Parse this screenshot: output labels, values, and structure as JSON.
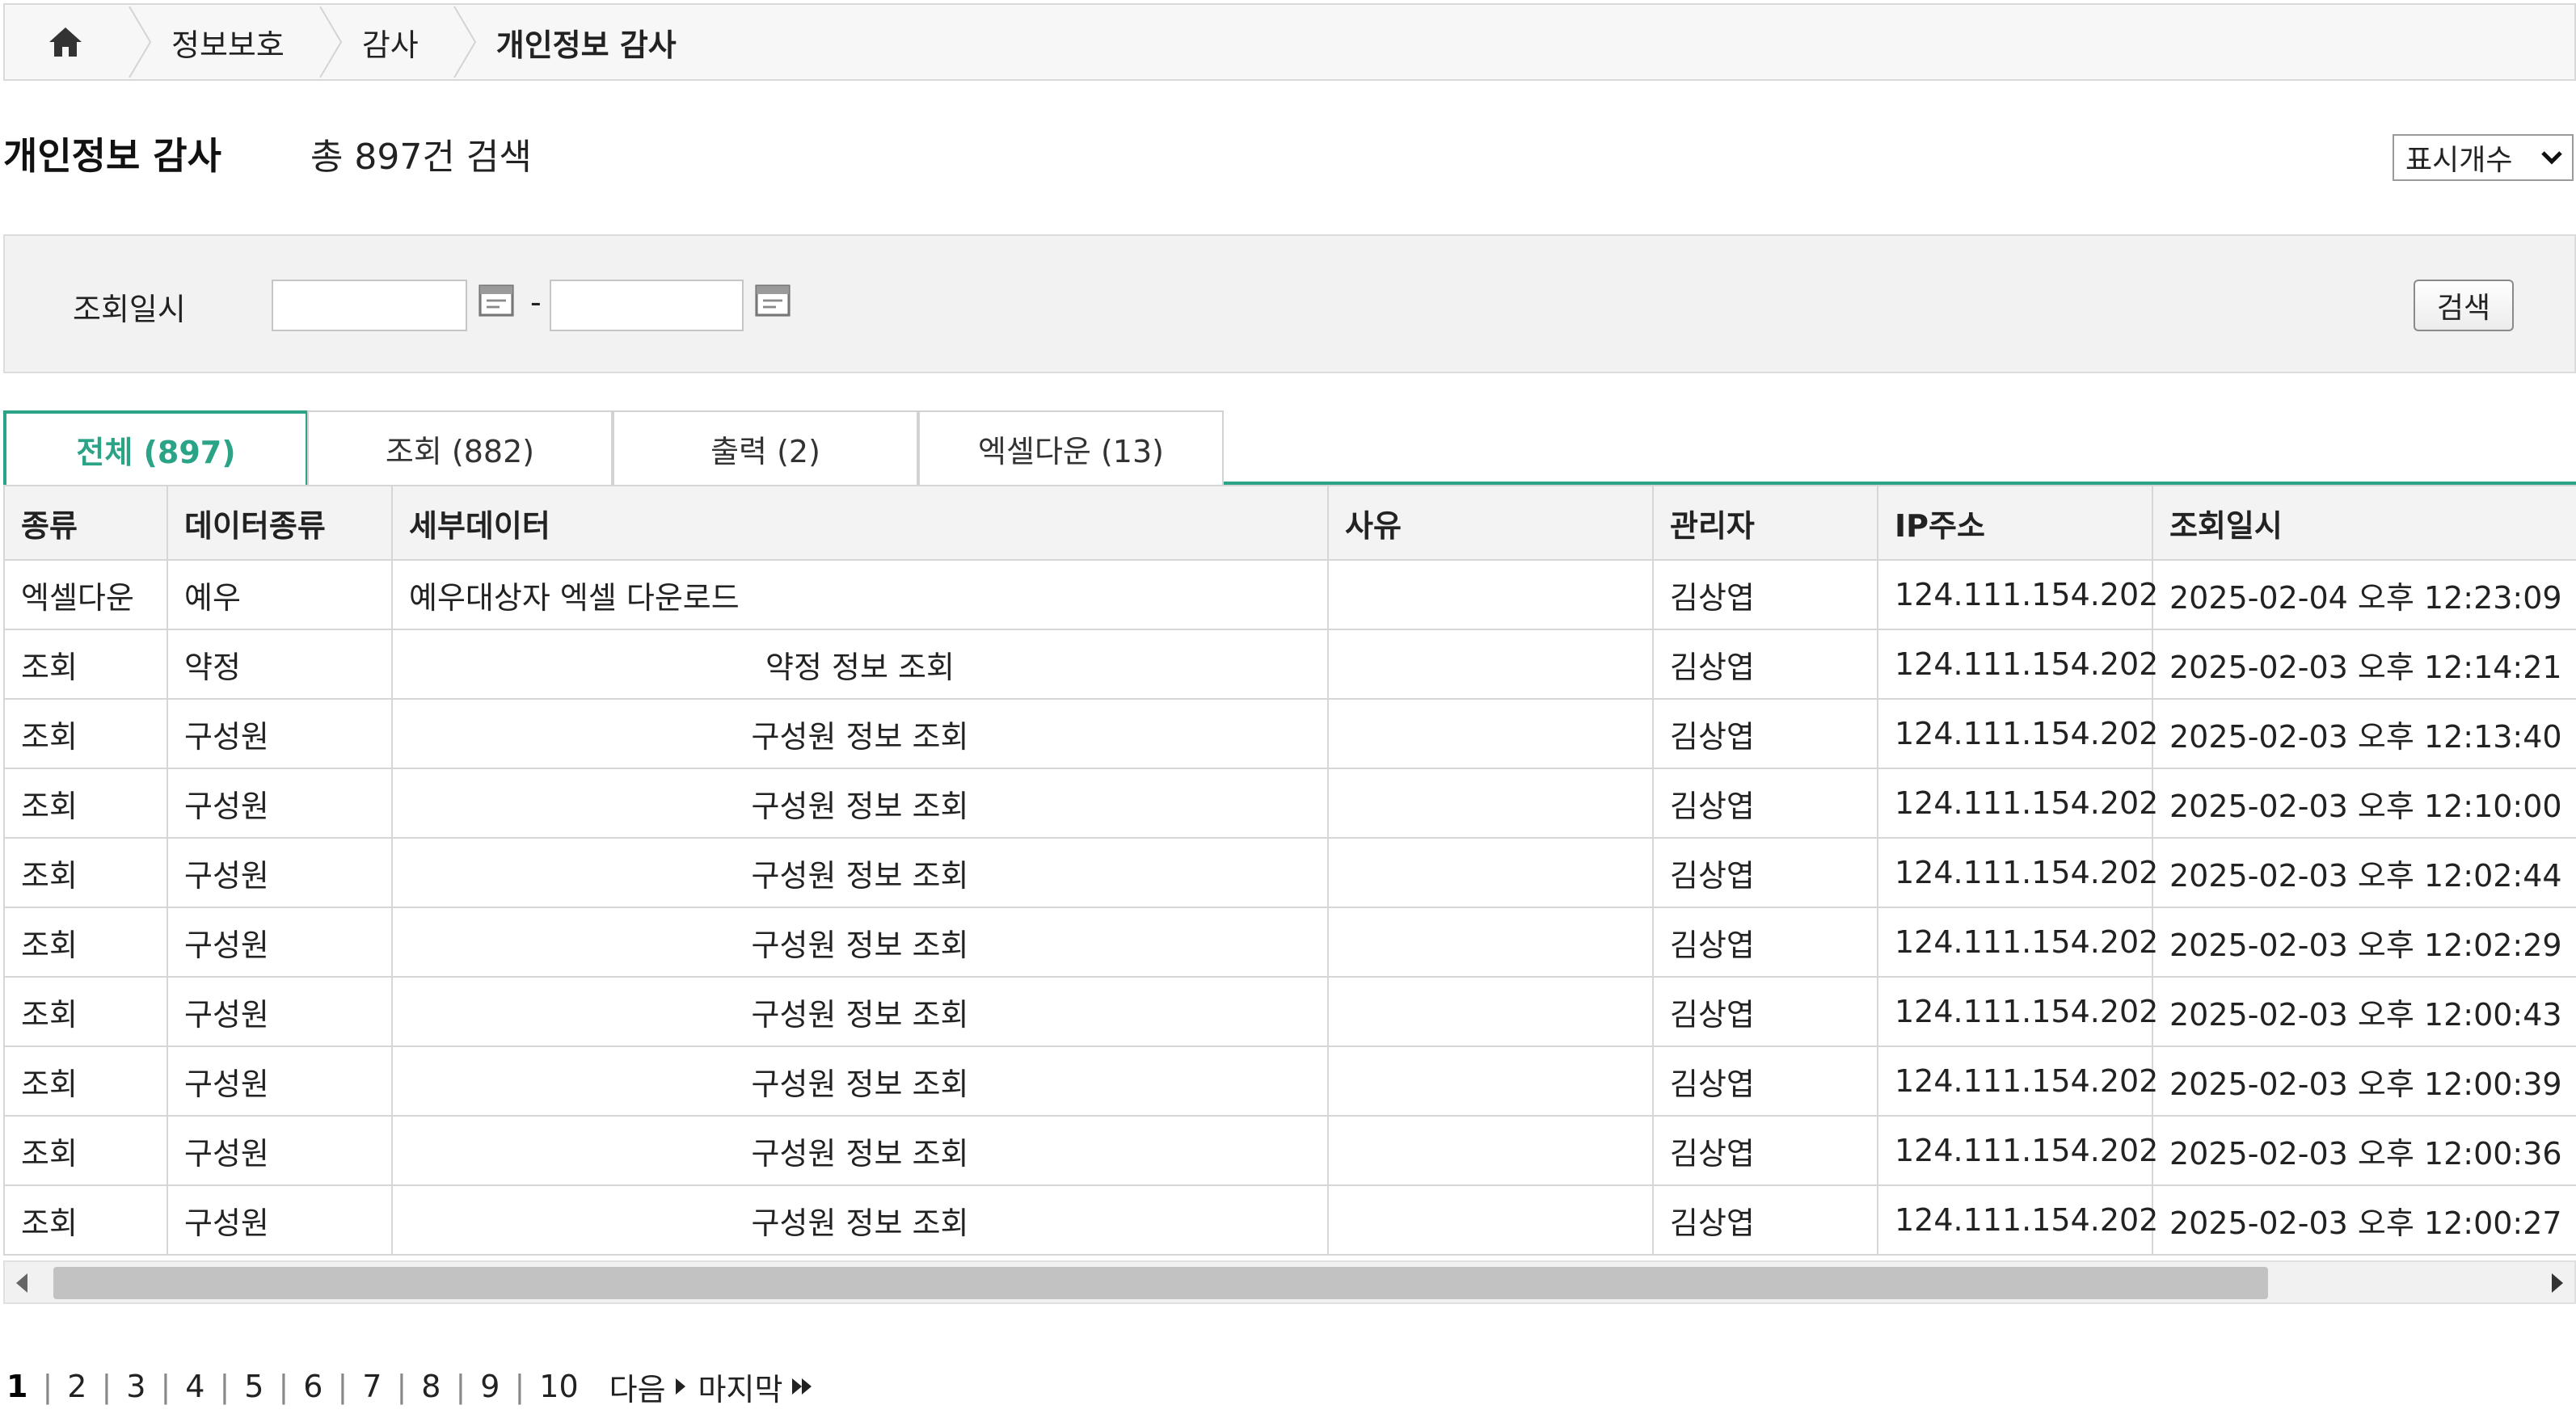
{
  "breadcrumb": {
    "items": [
      "정보보호",
      "감사",
      "개인정보 감사"
    ]
  },
  "header": {
    "title": "개인정보 감사",
    "total_text": "총 897건 검색",
    "display_count_label": "표시개수"
  },
  "search": {
    "date_label": "조회일시",
    "start_value": "",
    "end_value": "",
    "dash": "-",
    "button_label": "검색"
  },
  "tabs": [
    {
      "label": "전체 (897)",
      "active": true
    },
    {
      "label": "조회 (882)",
      "active": false
    },
    {
      "label": "출력 (2)",
      "active": false
    },
    {
      "label": "엑셀다운 (13)",
      "active": false
    }
  ],
  "table": {
    "columns": [
      "종류",
      "데이터종류",
      "세부데이터",
      "사유",
      "관리자",
      "IP주소",
      "조회일시"
    ],
    "rows": [
      [
        "엑셀다운",
        "예우",
        "예우대상자 엑셀 다운로드",
        "",
        "김상엽",
        "124.111.154.202",
        "2025-02-04 오후 12:23:09"
      ],
      [
        "조회",
        "약정",
        "약정 정보 조회",
        "",
        "김상엽",
        "124.111.154.202",
        "2025-02-03 오후 12:14:21"
      ],
      [
        "조회",
        "구성원",
        "구성원 정보 조회",
        "",
        "김상엽",
        "124.111.154.202",
        "2025-02-03 오후 12:13:40"
      ],
      [
        "조회",
        "구성원",
        "구성원 정보 조회",
        "",
        "김상엽",
        "124.111.154.202",
        "2025-02-03 오후 12:10:00"
      ],
      [
        "조회",
        "구성원",
        "구성원 정보 조회",
        "",
        "김상엽",
        "124.111.154.202",
        "2025-02-03 오후 12:02:44"
      ],
      [
        "조회",
        "구성원",
        "구성원 정보 조회",
        "",
        "김상엽",
        "124.111.154.202",
        "2025-02-03 오후 12:02:29"
      ],
      [
        "조회",
        "구성원",
        "구성원 정보 조회",
        "",
        "김상엽",
        "124.111.154.202",
        "2025-02-03 오후 12:00:43"
      ],
      [
        "조회",
        "구성원",
        "구성원 정보 조회",
        "",
        "김상엽",
        "124.111.154.202",
        "2025-02-03 오후 12:00:39"
      ],
      [
        "조회",
        "구성원",
        "구성원 정보 조회",
        "",
        "김상엽",
        "124.111.154.202",
        "2025-02-03 오후 12:00:36"
      ],
      [
        "조회",
        "구성원",
        "구성원 정보 조회",
        "",
        "김상엽",
        "124.111.154.202",
        "2025-02-03 오후 12:00:27"
      ]
    ]
  },
  "pagination": {
    "pages": [
      "1",
      "2",
      "3",
      "4",
      "5",
      "6",
      "7",
      "8",
      "9",
      "10"
    ],
    "current": "1",
    "next_label": "다음",
    "last_label": "마지막"
  },
  "colors": {
    "accent": "#2aa387",
    "header_bg": "#f3f3f3",
    "panel_bg": "#f2f2f2"
  }
}
